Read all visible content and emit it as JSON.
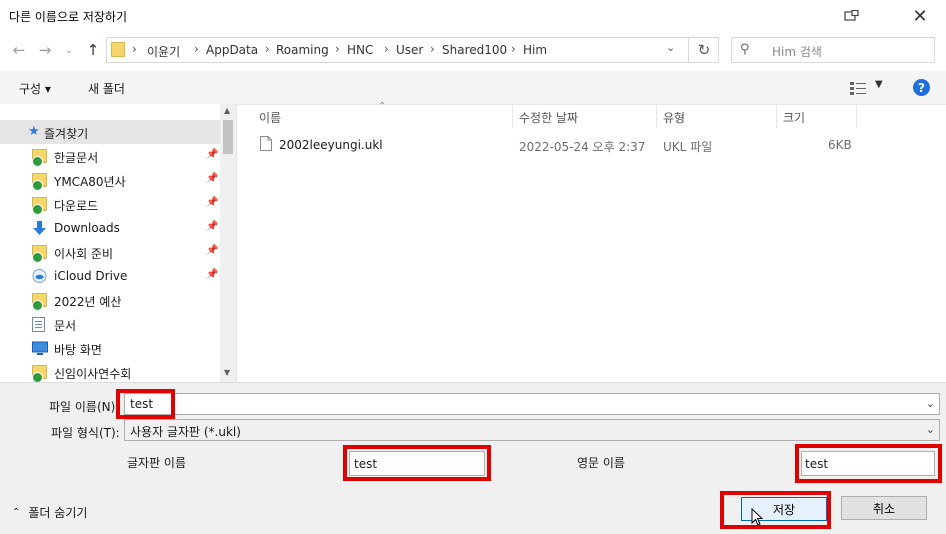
{
  "window": {
    "title": "다른 이름으로 저장하기"
  },
  "address": {
    "crumbs": [
      "이윤기",
      "AppData",
      "Roaming",
      "HNC",
      "User",
      "Shared100",
      "Him"
    ],
    "search_placeholder": "Him 검색"
  },
  "toolbar": {
    "organize": "구성 ▾",
    "new_folder": "새 폴더"
  },
  "nav": {
    "quick_access": "즐겨찾기",
    "items": [
      {
        "label": "한글문서",
        "icon": "folder-synced-icon",
        "pinned": true
      },
      {
        "label": "YMCA80년사",
        "icon": "folder-synced-icon",
        "pinned": true
      },
      {
        "label": "다운로드",
        "icon": "folder-synced-icon",
        "pinned": true
      },
      {
        "label": "Downloads",
        "icon": "download-arrow-icon",
        "pinned": true
      },
      {
        "label": "이사회 준비",
        "icon": "folder-shared-icon",
        "pinned": true
      },
      {
        "label": "iCloud Drive",
        "icon": "cloud-icon",
        "pinned": true
      },
      {
        "label": "2022년 예산",
        "icon": "folder-shared-icon",
        "pinned": false
      },
      {
        "label": "문서",
        "icon": "document-icon",
        "pinned": false
      },
      {
        "label": "바탕 화면",
        "icon": "desktop-icon",
        "pinned": false
      },
      {
        "label": "신임이사연수회",
        "icon": "folder-shared-icon",
        "pinned": false
      }
    ]
  },
  "filelist": {
    "columns": [
      "이름",
      "수정한 날짜",
      "유형",
      "크기"
    ],
    "rows": [
      {
        "name": "2002leeyungi.ukl",
        "modified": "2022-05-24 오후 2:37",
        "type": "UKL 파일",
        "size": "6KB"
      }
    ]
  },
  "form": {
    "filename_label": "파일 이름(N):",
    "filename_value": "test",
    "filetype_label": "파일 형식(T):",
    "filetype_value": "사용자 글자판 (*.ukl)",
    "korean_name_label": "글자판 이름",
    "korean_name_value": "test",
    "english_name_label": "영문 이름",
    "english_name_value": "test",
    "hide_folders": "폴더 숨기기",
    "save": "저장",
    "cancel": "취소"
  },
  "colors": {
    "highlight": "#e00000",
    "accent": "#0067c0",
    "help": "#1e6fd9"
  }
}
